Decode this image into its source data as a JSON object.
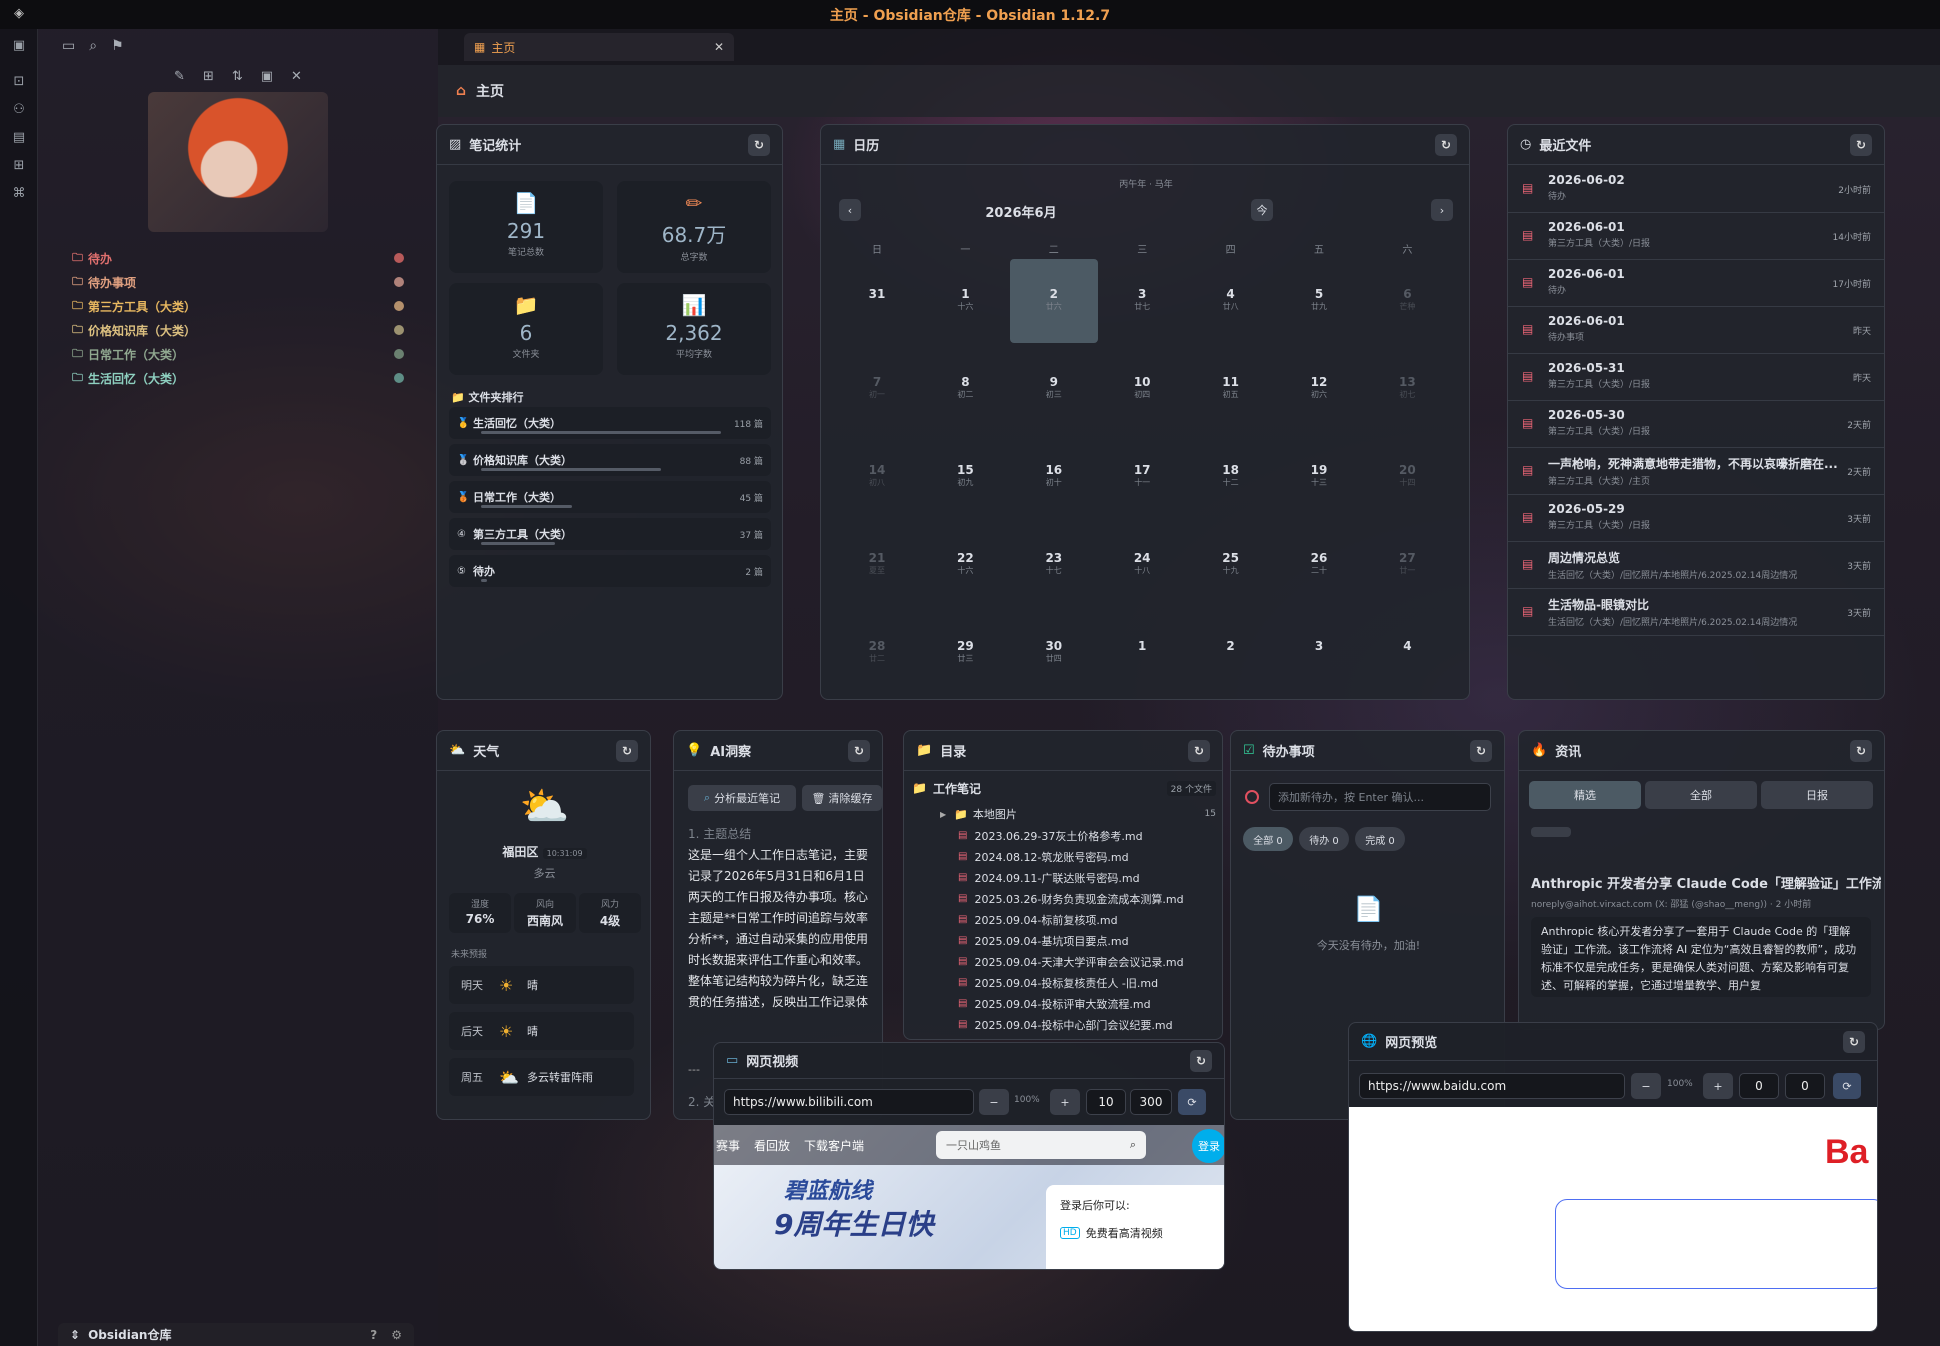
{
  "window": {
    "title": "主页 - Obsidian仓库 - Obsidian 1.12.7"
  },
  "colors": {
    "accent": "#f0a050",
    "panel": "#22252c",
    "selected_day": "#4c5a64"
  },
  "tab": {
    "label": "主页",
    "icon": "layout-icon"
  },
  "view_header": {
    "title": "主页",
    "icon": "home-icon"
  },
  "sidebar": {
    "tree": [
      {
        "label": "待办",
        "color": "#e0706e",
        "dot": "#b85a5a"
      },
      {
        "label": "待办事项",
        "color": "#e0a080",
        "dot": "#b0827a"
      },
      {
        "label": "第三方工具（大类）",
        "color": "#e8b860",
        "dot": "#b4906c"
      },
      {
        "label": "价格知识库（大类）",
        "color": "#dcc080",
        "dot": "#9c9270"
      },
      {
        "label": "日常工作（大类）",
        "color": "#90a890",
        "dot": "#6a8070"
      },
      {
        "label": "生活回忆（大类）",
        "color": "#8ed0c0",
        "dot": "#5e8e86"
      }
    ],
    "vault_name": "Obsidian仓库"
  },
  "stats": {
    "title": "笔记统计",
    "items": [
      {
        "value": "291",
        "label": "笔记总数"
      },
      {
        "value": "68.7万",
        "label": "总字数"
      },
      {
        "value": "6",
        "label": "文件夹"
      },
      {
        "value": "2,362",
        "label": "平均字数"
      }
    ],
    "ranking_title": "文件夹排行",
    "ranking": [
      {
        "name": "生活回忆（大类）",
        "count": "118 篇",
        "ratio": 1.0
      },
      {
        "name": "价格知识库（大类）",
        "count": "88 篇",
        "ratio": 0.75
      },
      {
        "name": "日常工作（大类）",
        "count": "45 篇",
        "ratio": 0.38
      },
      {
        "name": "第三方工具（大类）",
        "count": "37 篇",
        "ratio": 0.31
      },
      {
        "name": "待办",
        "count": "2 篇",
        "ratio": 0.02
      }
    ]
  },
  "calendar": {
    "title": "日历",
    "year_label": "丙午年 · 马年",
    "month": "2026年6月",
    "today_btn": "今",
    "weekdays": [
      "日",
      "一",
      "二",
      "三",
      "四",
      "五",
      "六"
    ],
    "days": [
      {
        "n": "31",
        "l": "",
        "dim": false
      },
      {
        "n": "1",
        "l": "十六",
        "dim": false
      },
      {
        "n": "2",
        "l": "廿六",
        "sel": true
      },
      {
        "n": "3",
        "l": "廿七"
      },
      {
        "n": "4",
        "l": "廿八"
      },
      {
        "n": "5",
        "l": "廿九"
      },
      {
        "n": "6",
        "l": "芒种",
        "dim": true
      },
      {
        "n": "7",
        "l": "初一",
        "dim": true
      },
      {
        "n": "8",
        "l": "初二"
      },
      {
        "n": "9",
        "l": "初三"
      },
      {
        "n": "10",
        "l": "初四"
      },
      {
        "n": "11",
        "l": "初五"
      },
      {
        "n": "12",
        "l": "初六"
      },
      {
        "n": "13",
        "l": "初七",
        "dim": true
      },
      {
        "n": "14",
        "l": "初八",
        "dim": true
      },
      {
        "n": "15",
        "l": "初九"
      },
      {
        "n": "16",
        "l": "初十"
      },
      {
        "n": "17",
        "l": "十一"
      },
      {
        "n": "18",
        "l": "十二"
      },
      {
        "n": "19",
        "l": "十三"
      },
      {
        "n": "20",
        "l": "十四",
        "dim": true
      },
      {
        "n": "21",
        "l": "夏至",
        "dim": true
      },
      {
        "n": "22",
        "l": "十六"
      },
      {
        "n": "23",
        "l": "十七"
      },
      {
        "n": "24",
        "l": "十八"
      },
      {
        "n": "25",
        "l": "十九"
      },
      {
        "n": "26",
        "l": "二十"
      },
      {
        "n": "27",
        "l": "廿一",
        "dim": true
      },
      {
        "n": "28",
        "l": "廿二",
        "dim": true
      },
      {
        "n": "29",
        "l": "廿三"
      },
      {
        "n": "30",
        "l": "廿四"
      },
      {
        "n": "1",
        "l": ""
      },
      {
        "n": "2",
        "l": ""
      },
      {
        "n": "3",
        "l": ""
      },
      {
        "n": "4",
        "l": ""
      }
    ]
  },
  "recent": {
    "title": "最近文件",
    "items": [
      {
        "t": "2026-06-02",
        "s": "待办",
        "tm": "2小时前"
      },
      {
        "t": "2026-06-01",
        "s": "第三方工具（大类）/日报",
        "tm": "14小时前"
      },
      {
        "t": "2026-06-01",
        "s": "待办",
        "tm": "17小时前"
      },
      {
        "t": "2026-06-01",
        "s": "待办事项",
        "tm": "昨天"
      },
      {
        "t": "2026-05-31",
        "s": "第三方工具（大类）/日报",
        "tm": "昨天"
      },
      {
        "t": "2026-05-30",
        "s": "第三方工具（大类）/日报",
        "tm": "2天前"
      },
      {
        "t": "一声枪响，死神满意地带走猎物，不再以哀嚎折磨在...",
        "s": "第三方工具（大类）/主页",
        "tm": "2天前"
      },
      {
        "t": "2026-05-29",
        "s": "第三方工具（大类）/日报",
        "tm": "3天前"
      },
      {
        "t": "周边情况总览",
        "s": "生活回忆（大类）/回忆照片/本地照片/6.2025.02.14周边情况",
        "tm": "3天前"
      },
      {
        "t": "生活物品-眼镜对比",
        "s": "生活回忆（大类）/回忆照片/本地照片/6.2025.02.14周边情况",
        "tm": "3天前"
      }
    ]
  },
  "weather": {
    "title": "天气",
    "location": "福田区",
    "time": "10:31:09",
    "condition": "多云",
    "humidity_label": "湿度",
    "humidity": "76%",
    "wind_dir_label": "风向",
    "wind_dir": "西南风",
    "wind_label": "风力",
    "wind": "4级",
    "forecast_title": "未来预报",
    "forecast": [
      {
        "d": "明天",
        "c": "晴"
      },
      {
        "d": "后天",
        "c": "晴"
      },
      {
        "d": "周五",
        "c": "多云转雷阵雨"
      }
    ]
  },
  "ai": {
    "title": "AI洞察",
    "analyze_btn": "分析最近笔记",
    "clear_btn": "清除缓存",
    "heading1": "1. 主题总结",
    "body": "这是一组个人工作日志笔记，主要记录了2026年5月31日和6月1日两天的工作日报及待办事项。核心主题是**日常工作时间追踪与效率分析**，通过自动采集的应用使用时长数据来评估工作重心和效率。整体笔记结构较为碎片化，缺乏连贯的任务描述，反映出工作记录体系尚在建立初期或数据采集不够完善。",
    "sep": "---",
    "heading2": "2. 关"
  },
  "toc": {
    "title": "目录",
    "folder": "工作笔记",
    "folder_count": "28 个文件",
    "sub": "本地图片",
    "sub_count": "15",
    "files": [
      "2023.06.29-37灰土价格参考.md",
      "2024.08.12-筑龙账号密码.md",
      "2024.09.11-广联达账号密码.md",
      "2025.03.26-财务负责现金流成本测算.md",
      "2025.09.04-标前复核项.md",
      "2025.09.04-基坑项目要点.md",
      "2025.09.04-天津大学评审会会议记录.md",
      "2025.09.04-投标复核责任人 -旧.md",
      "2025.09.04-投标评审大致流程.md",
      "2025.09.04-投标中心部门会议纪要.md"
    ]
  },
  "todo": {
    "title": "待办事项",
    "placeholder": "添加新待办，按 Enter 确认...",
    "filters": [
      "全部 0",
      "待办 0",
      "完成 0"
    ],
    "empty": "今天没有待办，加油!"
  },
  "news": {
    "title": "资讯",
    "tabs": [
      "精选",
      "全部",
      "日报"
    ],
    "headline": "Anthropic 开发者分享 Claude Code「理解验证」工作流",
    "meta": "noreply@aihot.virxact.com (X: 邵猛 (@shao__meng)) · 2 小时前",
    "summary": "Anthropic 核心开发者分享了一套用于 Claude Code 的「理解验证」工作流。该工作流将 AI 定位为“高效且睿智的教师”，成功标准不仅是完成任务，更是确保人类对问题、方案及影响有可复述、可解释的掌握，它通过增量教学、用户复"
  },
  "video": {
    "title": "网页视频",
    "url": "https://www.bilibili.com",
    "zoom": "100%",
    "a": "10",
    "b": "300",
    "nav": [
      "赛事",
      "看回放",
      "下载客户端"
    ],
    "search": "一只山鸡鱼",
    "login": "登录",
    "banner_text": "碧蓝航线",
    "banner_big": "9周年生日快",
    "login_hint": "登录后你可以:",
    "hd_hint": "免费看高清视频"
  },
  "preview": {
    "title": "网页预览",
    "url": "https://www.baidu.com",
    "zoom": "100%",
    "a": "0",
    "b": "0",
    "logo": "Ba"
  }
}
